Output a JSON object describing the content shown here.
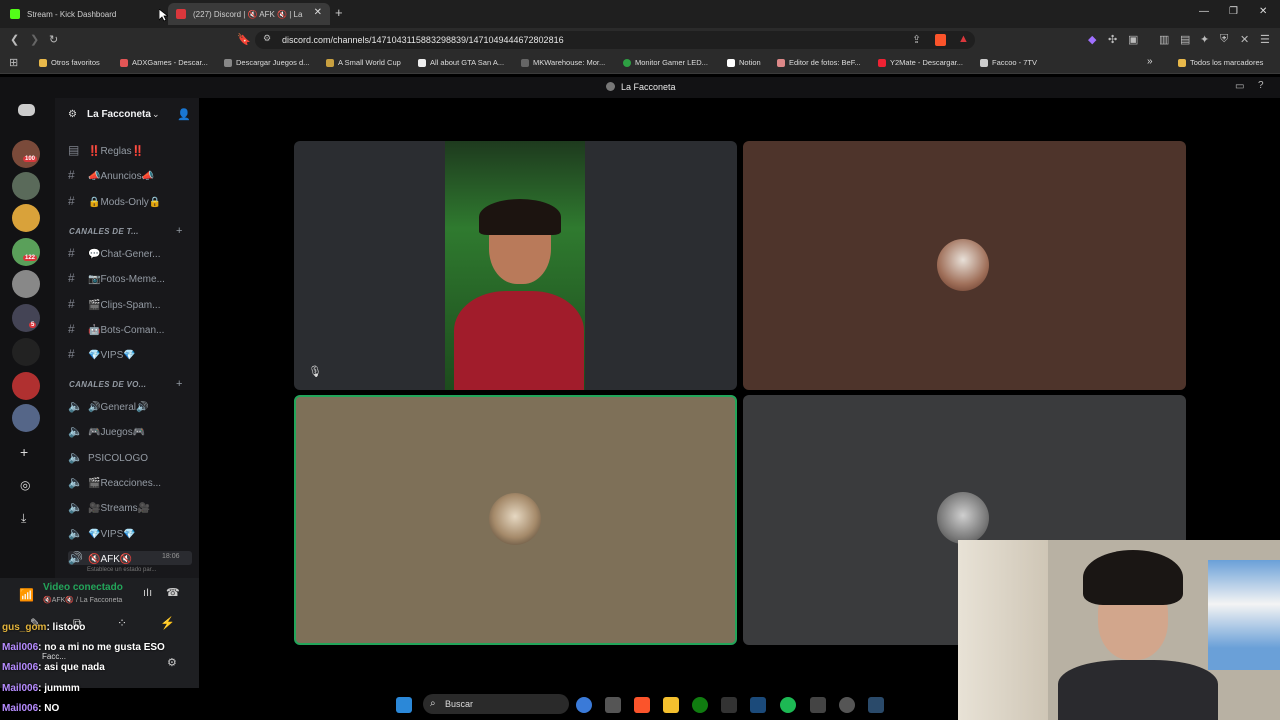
{
  "browser": {
    "tabs": [
      {
        "label": "Stream - Kick Dashboard",
        "favicon_color": "#53fc18"
      },
      {
        "label": "(227) Discord | 🔇 AFK 🔇 | La",
        "favicon_color": "#da373c"
      }
    ],
    "new_tab": "+",
    "window_controls": {
      "minimize": "—",
      "maximize": "❐",
      "close": "✕"
    },
    "url": "discord.com/channels/1471043115883298839/1471049444672802816",
    "bookmarks": [
      {
        "label": "Otros favoritos",
        "color": "#e8b84a"
      },
      {
        "label": "ADXGames - Descar...",
        "color": "#e25555"
      },
      {
        "label": "Descargar Juegos d...",
        "color": "#888"
      },
      {
        "label": "A Small World Cup",
        "color": "#c8a040"
      },
      {
        "label": "All about GTA San A...",
        "color": "#eee"
      },
      {
        "label": "MKWarehouse: Mor...",
        "color": "#666"
      },
      {
        "label": "Monitor Gamer LED...",
        "color": "#2ea043"
      },
      {
        "label": "Notion",
        "color": "#fff"
      },
      {
        "label": "Editor de fotos: BeF...",
        "color": "#d88"
      },
      {
        "label": "Y2Mate - Descargar...",
        "color": "#e23"
      },
      {
        "label": "Faccoo - 7TV",
        "color": "#ccc"
      },
      {
        "label": "Todos los marcadores",
        "color": "#e8b84a"
      }
    ]
  },
  "discord": {
    "title": "La Facconeta",
    "server_name": "La Facconeta",
    "servers": [
      {
        "color": "#7a4a3a",
        "badge": "100"
      },
      {
        "color": "#5a6a5a",
        "badge": ""
      },
      {
        "color": "#d9a23a",
        "badge": ""
      },
      {
        "color": "#5aa05a",
        "badge": "122"
      },
      {
        "color": "#888888",
        "badge": ""
      },
      {
        "color": "#444455",
        "badge": "5"
      },
      {
        "color": "#222222",
        "badge": ""
      },
      {
        "color": "#b03030",
        "badge": ""
      },
      {
        "color": "#556688",
        "badge": ""
      }
    ],
    "rules_channel": "‼️Reglas‼️",
    "text_channels": [
      {
        "label": "📣Anuncios📣"
      },
      {
        "label": "🔒Mods-Only🔒"
      }
    ],
    "category_text": "CANALES DE T...",
    "chat_channels": [
      {
        "label": "💬Chat-Gener..."
      },
      {
        "label": "📷Fotos-Meme..."
      },
      {
        "label": "🎬Clips-Spam..."
      },
      {
        "label": "🤖Bots-Coman..."
      },
      {
        "label": "💎VIPS💎"
      }
    ],
    "category_voice": "CANALES DE VO...",
    "voice_channels": [
      {
        "label": "🔊General🔊"
      },
      {
        "label": "🎮Juegos🎮"
      },
      {
        "label": "PSICOLOGO"
      },
      {
        "label": "🎬Reacciones..."
      },
      {
        "label": "🎥Streams🎥"
      },
      {
        "label": "💎VIPS💎"
      }
    ],
    "active_channel": {
      "label": "🔇AFK🔇",
      "time": "18:06",
      "status_hint": "Establece un estado par..."
    },
    "voice_status": {
      "title": "Video conectado",
      "subtitle": "🔇AFK🔇 / La Facconeta"
    },
    "user_short": "Facc..."
  },
  "chat_overlay": [
    {
      "user": "gus_gom",
      "text": ": listooo",
      "user_color": "#e2b33c"
    },
    {
      "user": "Mail006",
      "text": ": no a mi no me gusta ESO",
      "user_color": "#b68cff"
    },
    {
      "user": "Mail006",
      "text": ": asi que nada",
      "user_color": "#b68cff"
    },
    {
      "user": "Mail006",
      "text": ": jummm",
      "user_color": "#b68cff"
    },
    {
      "user": "Mail006",
      "text": ": NO",
      "user_color": "#b68cff"
    }
  ],
  "taskbar": {
    "search_label": "Buscar"
  }
}
